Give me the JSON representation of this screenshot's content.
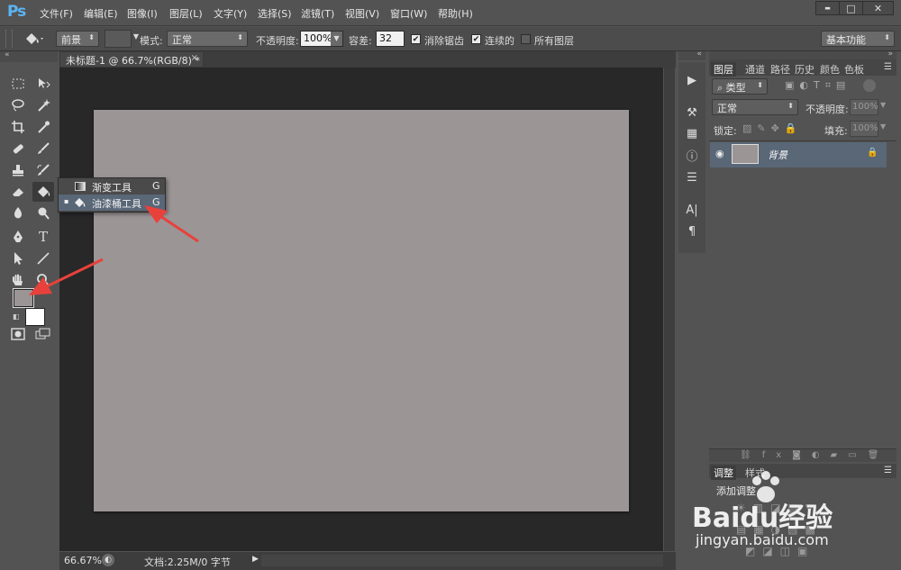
{
  "app": {
    "logo": "Ps",
    "menu": [
      "文件(F)",
      "编辑(E)",
      "图像(I)",
      "图层(L)",
      "文字(Y)",
      "选择(S)",
      "滤镜(T)",
      "视图(V)",
      "窗口(W)",
      "帮助(H)"
    ],
    "window_controls": {
      "minimize": "▬",
      "maximize": "□",
      "close": "✕"
    }
  },
  "options": {
    "fill_source": "前景",
    "mode_label": "模式:",
    "mode_value": "正常",
    "opacity_label": "不透明度:",
    "opacity_value": "100%",
    "tolerance_label": "容差:",
    "tolerance_value": "32",
    "antialias_label": "消除锯齿",
    "antialias_checked": true,
    "contiguous_label": "连续的",
    "contiguous_checked": true,
    "all_layers_label": "所有图层",
    "all_layers_checked": false,
    "workspace": "基本功能"
  },
  "document": {
    "tab_title": "未标题-1 @ 66.7%(RGB/8) *",
    "canvas_color": "#9b9596",
    "status_zoom": "66.67%",
    "status_doc": "文档:2.25M/0 字节"
  },
  "flyout": {
    "items": [
      {
        "label": "渐变工具",
        "shortcut": "G",
        "selected": false
      },
      {
        "label": "油漆桶工具",
        "shortcut": "G",
        "selected": true
      }
    ]
  },
  "layers_panel": {
    "tabs": [
      "图层",
      "通道",
      "路径",
      "历史",
      "颜色",
      "色板"
    ],
    "filter_type": "类型",
    "blend_mode": "正常",
    "opacity_label": "不透明度:",
    "opacity_value": "100%",
    "lock_label": "锁定:",
    "fill_label": "填充:",
    "fill_value": "100%",
    "layer_name": "背景"
  },
  "adjust_panel": {
    "tabs": [
      "调整",
      "样式"
    ],
    "add_label": "添加调整"
  },
  "watermark": {
    "line1": "Baidu经验",
    "line2": "jingyan.baidu.com"
  },
  "colors": {
    "foreground": "#9b9596",
    "background": "#ffffff",
    "arrow": "#e8413c",
    "selection": "#596777"
  }
}
